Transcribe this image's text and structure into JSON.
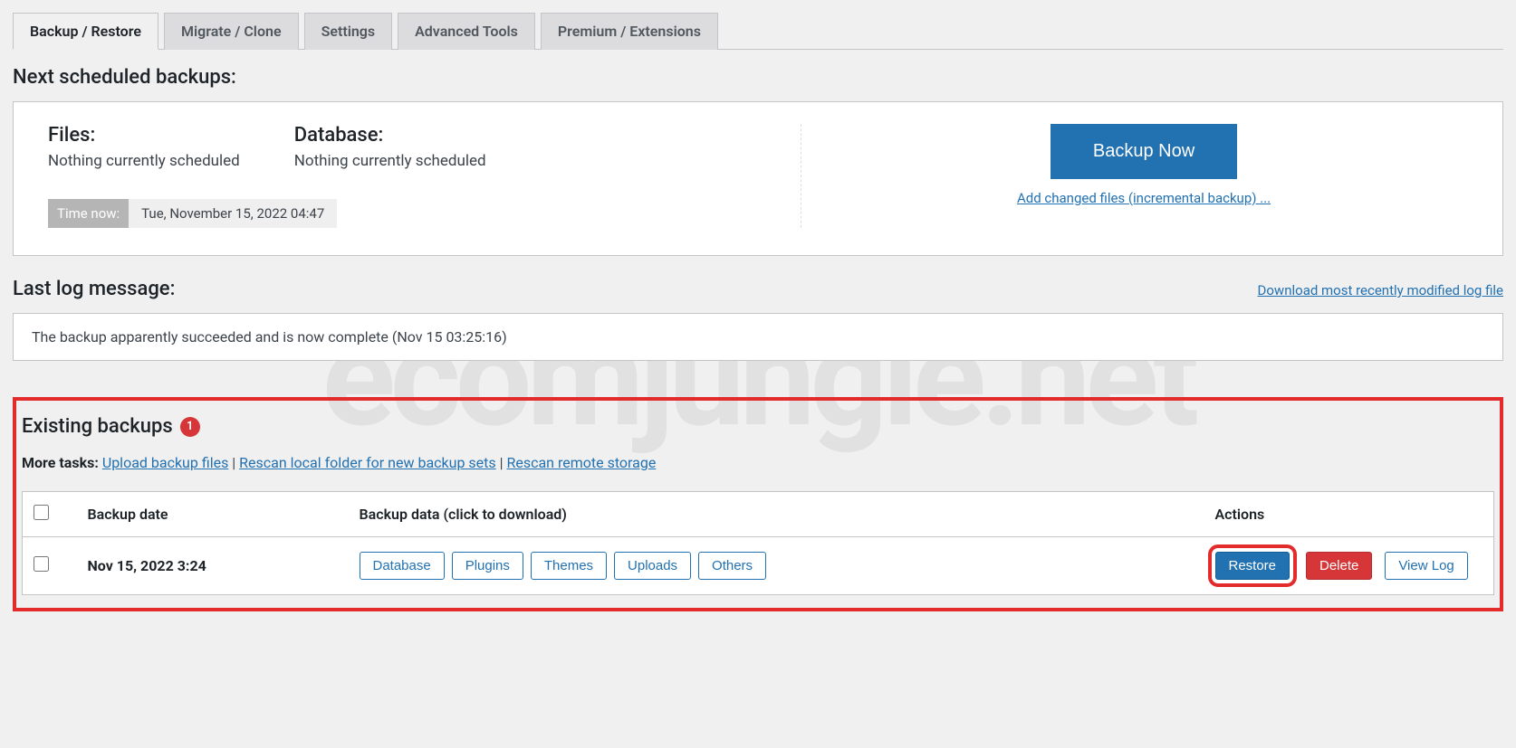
{
  "watermark": "ecomjungle.net",
  "tabs": [
    {
      "label": "Backup / Restore",
      "active": true
    },
    {
      "label": "Migrate / Clone",
      "active": false
    },
    {
      "label": "Settings",
      "active": false
    },
    {
      "label": "Advanced Tools",
      "active": false
    },
    {
      "label": "Premium / Extensions",
      "active": false
    }
  ],
  "scheduled": {
    "heading": "Next scheduled backups:",
    "files_label": "Files:",
    "files_status": "Nothing currently scheduled",
    "db_label": "Database:",
    "db_status": "Nothing currently scheduled",
    "time_now_label": "Time now:",
    "time_now_value": "Tue, November 15, 2022 04:47",
    "backup_now_button": "Backup Now",
    "incremental_link": "Add changed files (incremental backup) ..."
  },
  "last_log": {
    "heading": "Last log message:",
    "download_link": "Download most recently modified log file",
    "message": "The backup apparently succeeded and is now complete (Nov 15 03:25:16)"
  },
  "existing": {
    "heading": "Existing backups",
    "count": "1",
    "more_tasks_label": "More tasks:",
    "upload_link": "Upload backup files",
    "rescan_local_link": "Rescan local folder for new backup sets",
    "rescan_remote_link": "Rescan remote storage",
    "columns": {
      "date": "Backup date",
      "data": "Backup data (click to download)",
      "actions": "Actions"
    },
    "row": {
      "date": "Nov 15, 2022 3:24",
      "data_buttons": [
        "Database",
        "Plugins",
        "Themes",
        "Uploads",
        "Others"
      ],
      "restore": "Restore",
      "delete": "Delete",
      "viewlog": "View Log"
    }
  }
}
